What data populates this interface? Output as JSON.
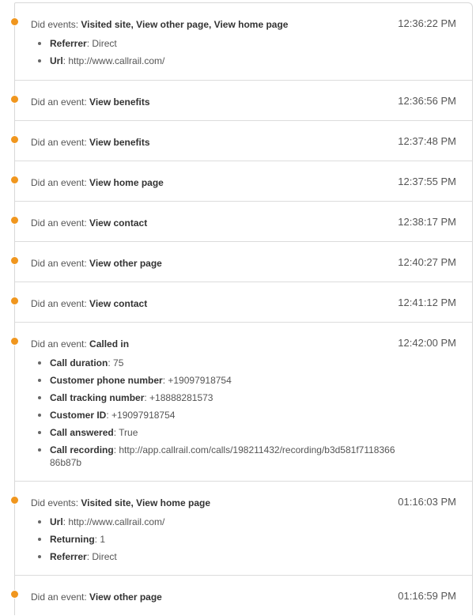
{
  "colors": {
    "dot": "#f0961e",
    "border": "#d8d8d8"
  },
  "events": [
    {
      "prefix": "Did events: ",
      "names": "Visited site, View other page, View home page",
      "time": "12:36:22 PM",
      "props": [
        {
          "k": "Referrer",
          "v": "Direct"
        },
        {
          "k": "Url",
          "v": "http://www.callrail.com/"
        }
      ]
    },
    {
      "prefix": "Did an event: ",
      "names": "View benefits",
      "time": "12:36:56 PM",
      "props": []
    },
    {
      "prefix": "Did an event: ",
      "names": "View benefits",
      "time": "12:37:48 PM",
      "props": []
    },
    {
      "prefix": "Did an event: ",
      "names": "View home page",
      "time": "12:37:55 PM",
      "props": []
    },
    {
      "prefix": "Did an event: ",
      "names": "View contact",
      "time": "12:38:17 PM",
      "props": []
    },
    {
      "prefix": "Did an event: ",
      "names": "View other page",
      "time": "12:40:27 PM",
      "props": []
    },
    {
      "prefix": "Did an event: ",
      "names": "View contact",
      "time": "12:41:12 PM",
      "props": []
    },
    {
      "prefix": "Did an event: ",
      "names": "Called in",
      "time": "12:42:00 PM",
      "props": [
        {
          "k": "Call duration",
          "v": "75"
        },
        {
          "k": "Customer phone number",
          "v": "+19097918754"
        },
        {
          "k": "Call tracking number",
          "v": "+18888281573"
        },
        {
          "k": "Customer ID",
          "v": "+19097918754"
        },
        {
          "k": "Call answered",
          "v": "True"
        },
        {
          "k": "Call recording",
          "v": "http://app.callrail.com/calls/198211432/recording/b3d581f711836686b87b"
        }
      ]
    },
    {
      "prefix": "Did events: ",
      "names": "Visited site, View home page",
      "time": "01:16:03 PM",
      "props": [
        {
          "k": "Url",
          "v": "http://www.callrail.com/"
        },
        {
          "k": "Returning",
          "v": "1"
        },
        {
          "k": "Referrer",
          "v": "Direct"
        }
      ]
    },
    {
      "prefix": "Did an event: ",
      "names": "View other page",
      "time": "01:16:59 PM",
      "props": []
    }
  ]
}
